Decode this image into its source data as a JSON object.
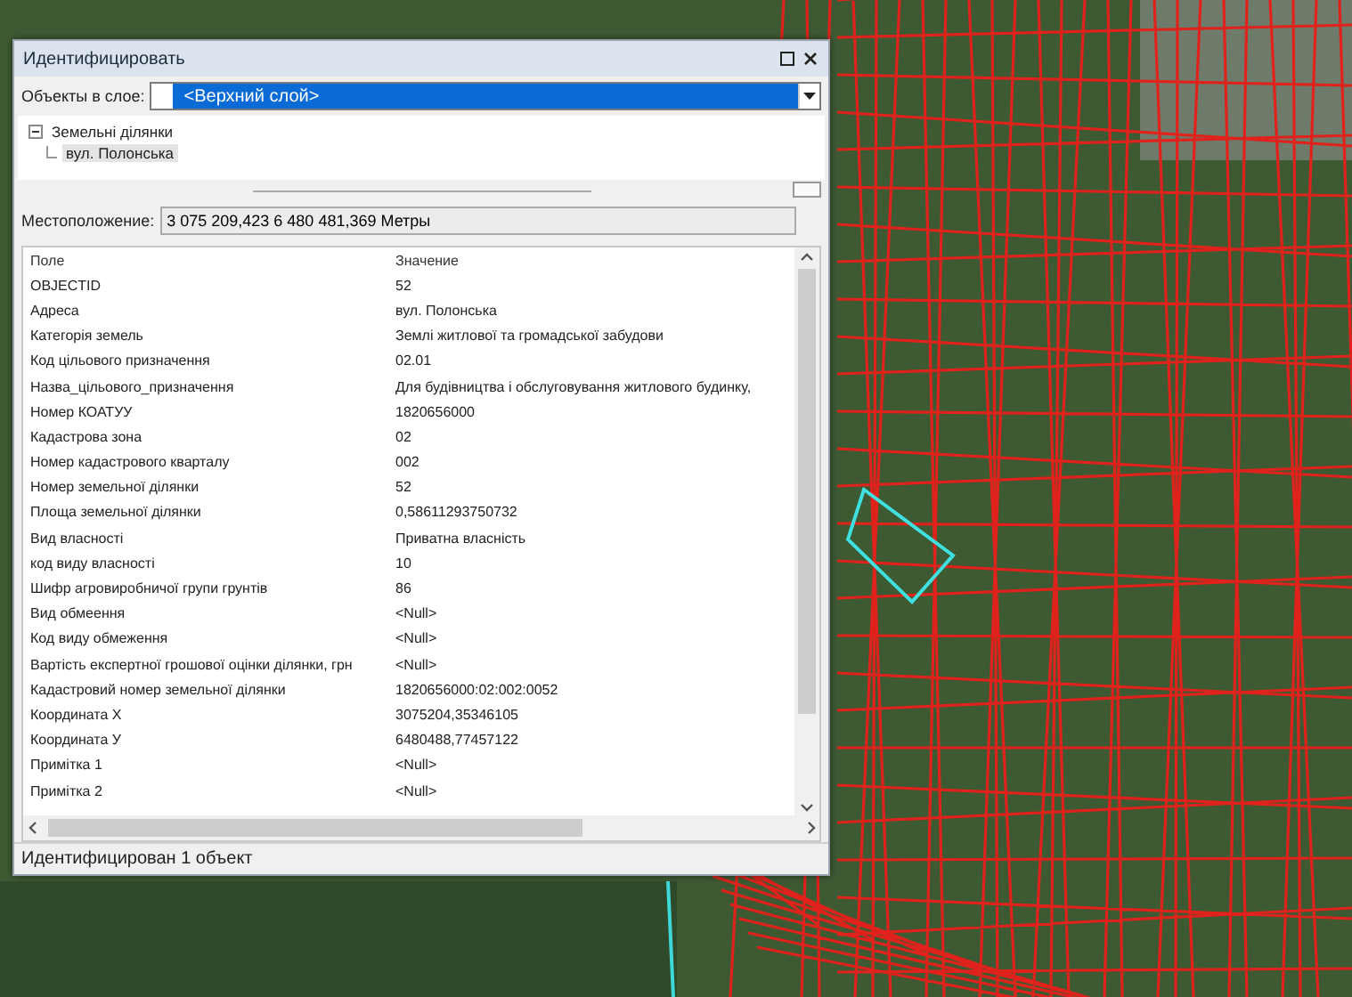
{
  "window": {
    "title": "Идентифицировать"
  },
  "layer_select": {
    "label": "Объекты в слое:",
    "value": "<Верхний слой>"
  },
  "tree": [
    {
      "label": "Земельні ділянки",
      "expanded": true,
      "selected": false,
      "children": [
        {
          "label": "вул. Полонська",
          "selected": true
        }
      ]
    }
  ],
  "location": {
    "label": "Местоположение:",
    "value": "3 075 209,423  6 480 481,369 Метры"
  },
  "table": {
    "columns": [
      "Поле",
      "Значение"
    ],
    "rows": [
      [
        "OBJECTID",
        "52"
      ],
      [
        "Адреса",
        "вул. Полонська"
      ],
      [
        "Категорія земель",
        "Землі житлової та громадської забудови"
      ],
      [
        "Код цільового призначення",
        "02.01"
      ],
      [
        "Назва_цільового_призначення",
        "Для будівництва і обслуговування житлового будинку,"
      ],
      [
        "Номер КОАТУУ",
        "1820656000"
      ],
      [
        "Кадастрова зона",
        "02"
      ],
      [
        "Номер кадастрового кварталу",
        "002"
      ],
      [
        "Номер земельної ділянки",
        "52"
      ],
      [
        "Площа земельної ділянки",
        "0,58611293750732"
      ],
      [
        "Вид власності",
        "Приватна власність"
      ],
      [
        "код виду власності",
        "10"
      ],
      [
        "Шифр агровиробничої групи грунтів",
        "86"
      ],
      [
        "Вид обмеення",
        "<Null>"
      ],
      [
        "Код виду обмеження",
        "<Null>"
      ],
      [
        "Вартість експертної грошової оцінки ділянки, грн",
        "<Null>"
      ],
      [
        "Кадастровий номер земельної ділянки",
        "1820656000:02:002:0052"
      ],
      [
        "Координата X",
        "3075204,35346105"
      ],
      [
        "Координата У",
        "6480488,77457122"
      ],
      [
        "Примітка 1",
        "<Null>"
      ],
      [
        "Примітка 2",
        "<Null>"
      ]
    ]
  },
  "status_bar": {
    "text": "Идентифицирован 1 объект"
  }
}
